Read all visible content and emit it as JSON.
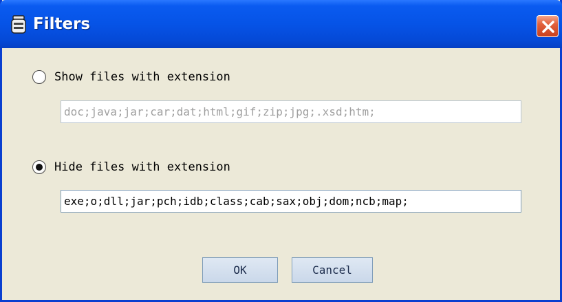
{
  "window": {
    "title": "Filters"
  },
  "options": {
    "show": {
      "label": "Show files with extension",
      "value": "doc;java;jar;car;dat;html;gif;zip;jpg;.xsd;htm;",
      "selected": false
    },
    "hide": {
      "label": "Hide files with extension",
      "value": "exe;o;dll;jar;pch;idb;class;cab;sax;obj;dom;ncb;map;",
      "selected": true
    }
  },
  "buttons": {
    "ok_label": "OK",
    "cancel_label": "Cancel"
  },
  "icons": {
    "app": "jar-icon",
    "close": "close-icon"
  },
  "colors": {
    "titlebar": "#0653e6",
    "window_background": "#ece9d8",
    "close_button": "#e2613c",
    "field_border": "#7f9db9",
    "disabled_text": "#a0a0a0"
  }
}
